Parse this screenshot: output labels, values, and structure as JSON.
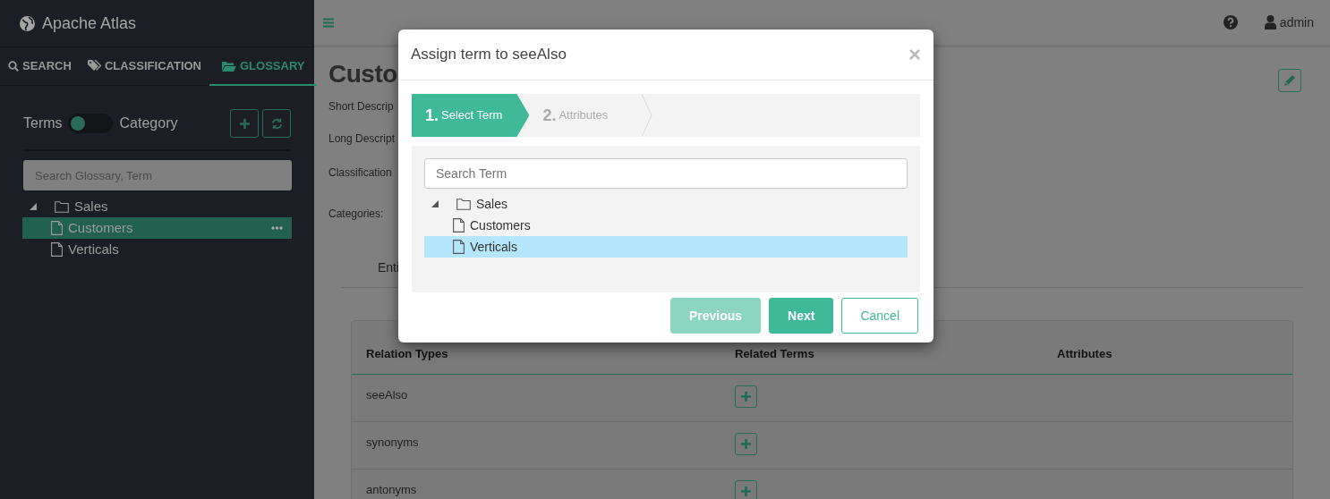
{
  "app": {
    "title": "Apache Atlas"
  },
  "sidebar": {
    "tabs": [
      {
        "label": "SEARCH",
        "kind": "search",
        "selected": false
      },
      {
        "label": "CLASSIFICATION",
        "kind": "tag",
        "selected": false
      },
      {
        "label": "GLOSSARY",
        "kind": "folder",
        "selected": true
      }
    ],
    "toggle": {
      "left_label": "Terms",
      "right_label": "Category",
      "on": false
    },
    "search": {
      "placeholder": "Search Glossary, Term"
    },
    "tree": [
      {
        "label": "Sales",
        "expanded": true,
        "children": [
          {
            "label": "Customers",
            "selected": true
          },
          {
            "label": "Verticals",
            "selected": false
          }
        ]
      }
    ]
  },
  "header": {
    "user": "admin"
  },
  "detail": {
    "title": "Custo",
    "fields": [
      "Short Descrip",
      "Long Descript",
      "Classification",
      "Categories:"
    ],
    "tab": "Enti"
  },
  "relations": {
    "columns": [
      "Relation Types",
      "Related Terms",
      "Attributes"
    ],
    "rows": [
      {
        "type": "seeAlso"
      },
      {
        "type": "synonyms"
      },
      {
        "type": "antonyms"
      }
    ]
  },
  "modal": {
    "title": "Assign term to seeAlso",
    "close": "×",
    "steps": [
      {
        "number": "1.",
        "label": "Select Term",
        "selected": true
      },
      {
        "number": "2.",
        "label": "Attributes",
        "selected": false
      }
    ],
    "search": {
      "placeholder": "Search Term"
    },
    "tree": [
      {
        "label": "Sales",
        "expanded": true,
        "children": [
          {
            "label": "Customers",
            "selected": false
          },
          {
            "label": "Verticals",
            "selected": true
          }
        ]
      }
    ],
    "buttons": [
      {
        "label": "Previous",
        "kind": "primary",
        "disabled": true
      },
      {
        "label": "Next",
        "kind": "primary",
        "disabled": false
      },
      {
        "label": "Cancel",
        "kind": "outline",
        "disabled": false
      }
    ]
  }
}
